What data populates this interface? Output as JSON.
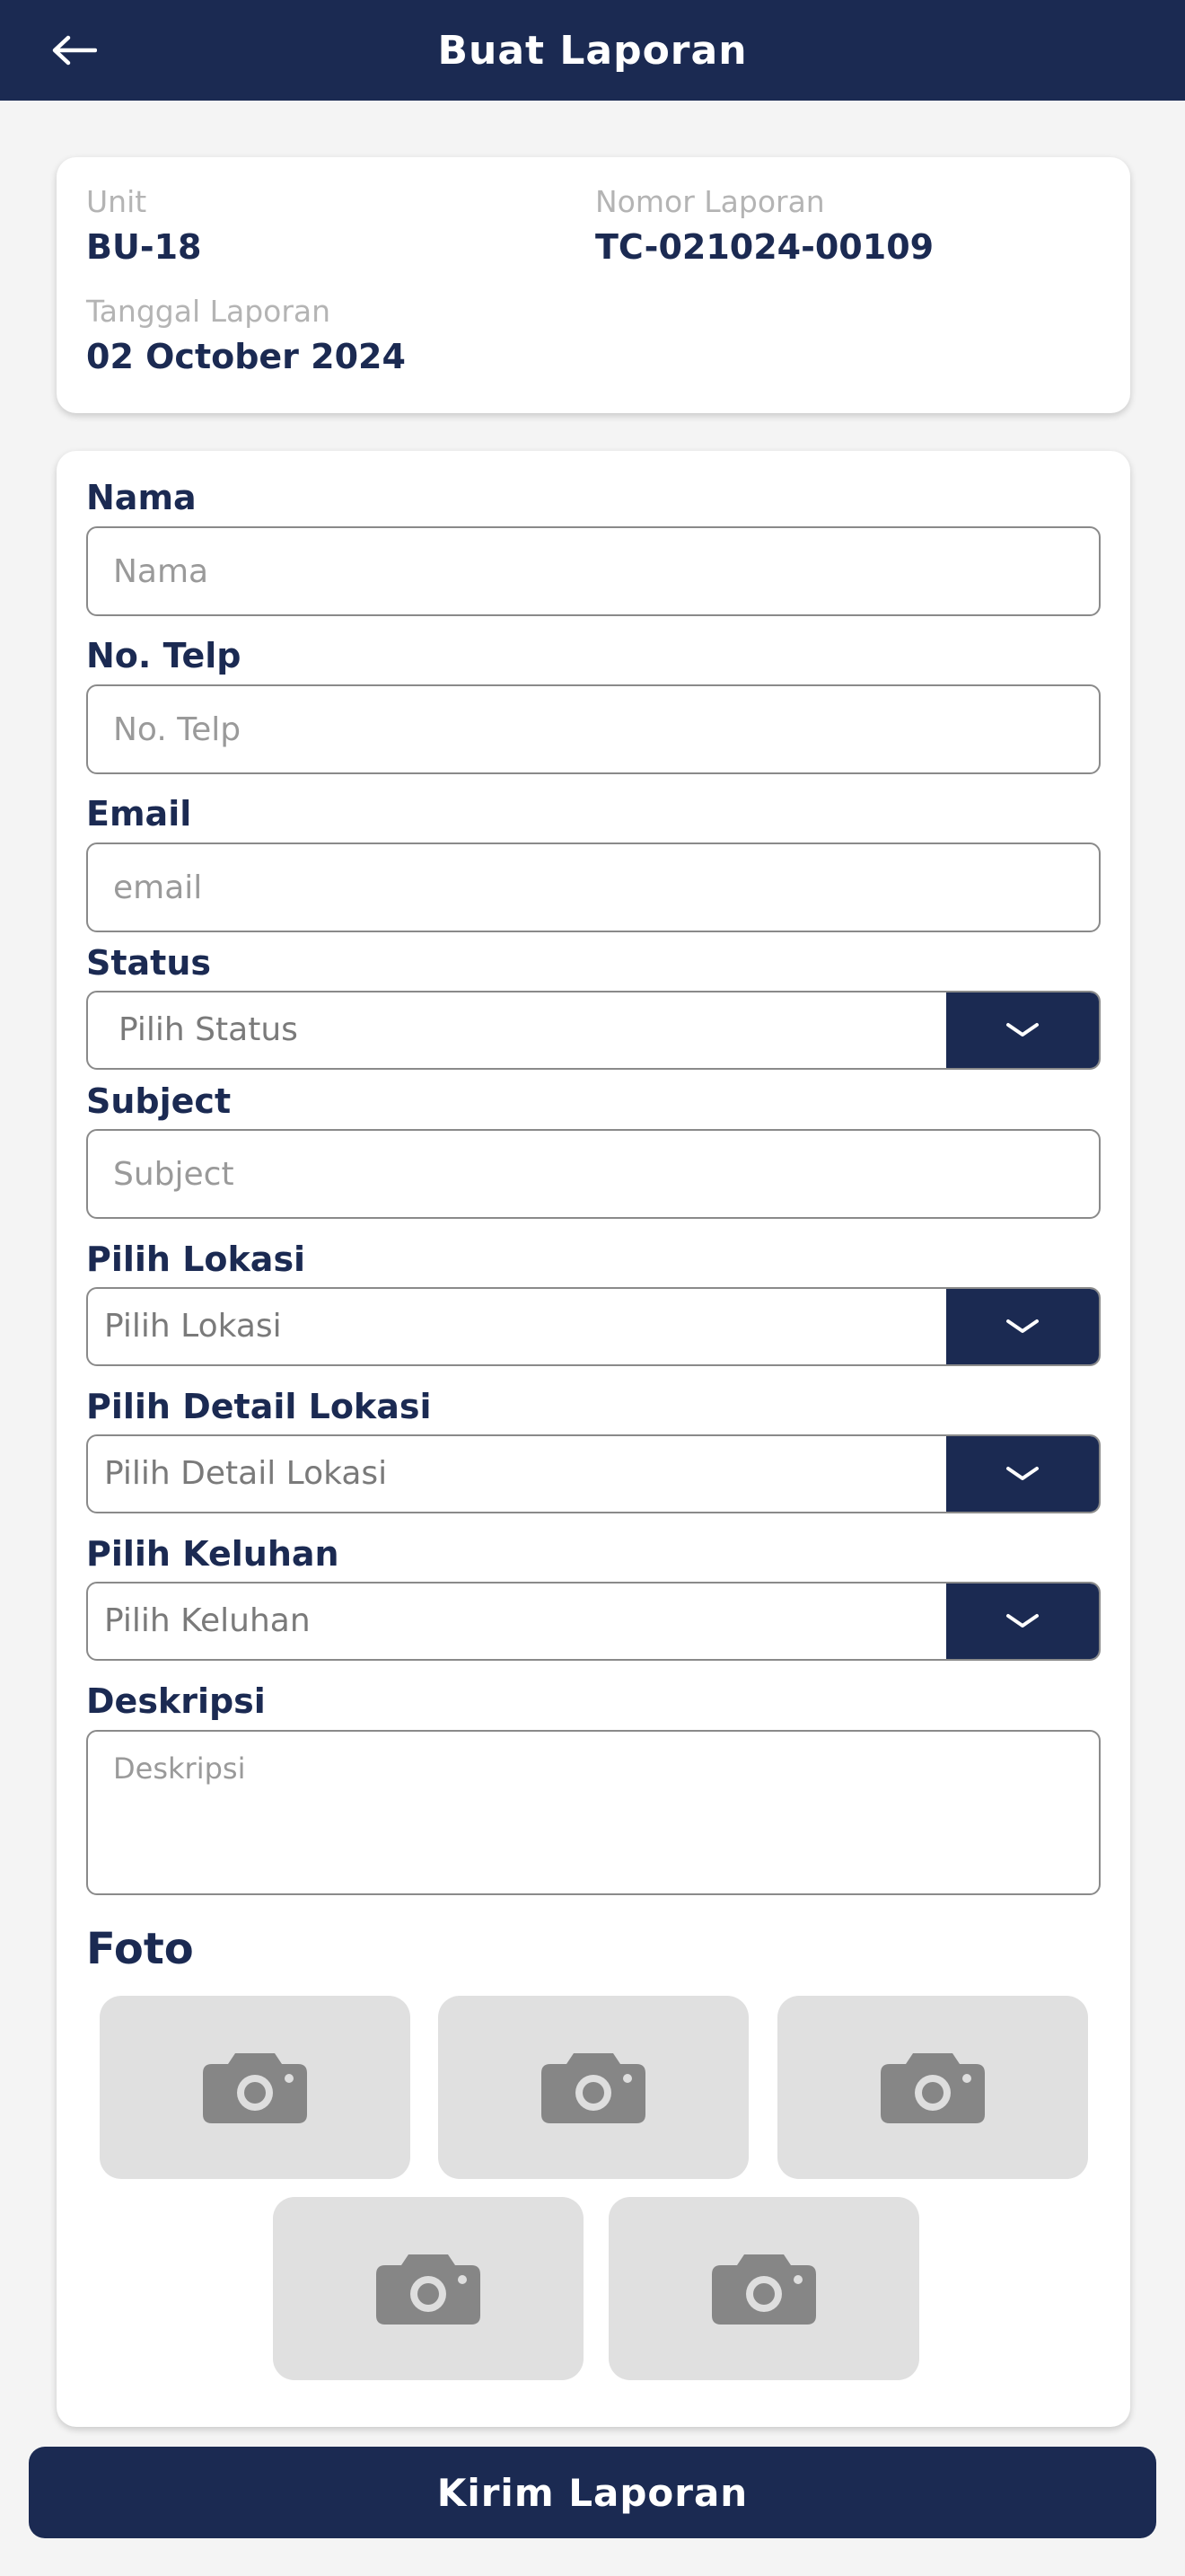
{
  "header": {
    "title": "Buat Laporan"
  },
  "info": {
    "unit_label": "Unit",
    "unit_value": "BU-18",
    "report_no_label": "Nomor Laporan",
    "report_no_value": "TC-021024-00109",
    "date_label": "Tanggal Laporan",
    "date_value": "02 October 2024"
  },
  "form": {
    "nama": {
      "label": "Nama",
      "placeholder": "Nama"
    },
    "telp": {
      "label": "No. Telp",
      "placeholder": "No. Telp"
    },
    "email": {
      "label": "Email",
      "placeholder": "email"
    },
    "status": {
      "label": "Status",
      "placeholder": "Pilih Status"
    },
    "subject": {
      "label": "Subject",
      "placeholder": "Subject"
    },
    "lokasi": {
      "label": "Pilih Lokasi",
      "placeholder": "Pilih Lokasi"
    },
    "detail_lokasi": {
      "label": "Pilih Detail Lokasi",
      "placeholder": "Pilih Detail Lokasi"
    },
    "keluhan": {
      "label": "Pilih Keluhan",
      "placeholder": "Pilih Keluhan"
    },
    "deskripsi": {
      "label": "Deskripsi",
      "placeholder": "Deskripsi"
    }
  },
  "photos": {
    "title": "Foto",
    "icon": "camera-icon"
  },
  "submit_label": "Kirim Laporan",
  "colors": {
    "primary": "#1b2a52",
    "background": "#f4f4f4",
    "photo_slot": "#e0e0e0"
  }
}
